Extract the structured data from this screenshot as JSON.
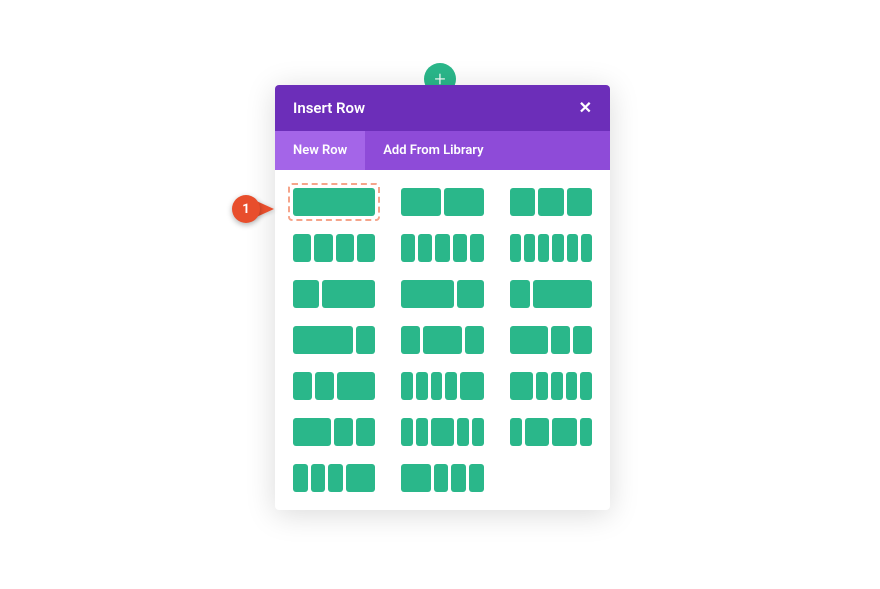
{
  "add_button": {
    "icon": "+"
  },
  "modal": {
    "title": "Insert Row",
    "close_icon": "✕",
    "tabs": [
      {
        "label": "New Row",
        "active": true
      },
      {
        "label": "Add From Library",
        "active": false
      }
    ]
  },
  "layouts": [
    {
      "cols": [
        1
      ],
      "selected": true
    },
    {
      "cols": [
        1,
        1
      ],
      "selected": false
    },
    {
      "cols": [
        1,
        1,
        1
      ],
      "selected": false
    },
    {
      "cols": [
        1,
        1,
        1,
        1
      ],
      "selected": false
    },
    {
      "cols": [
        1,
        1,
        1,
        1,
        1
      ],
      "selected": false
    },
    {
      "cols": [
        1,
        1,
        1,
        1,
        1,
        1
      ],
      "selected": false
    },
    {
      "cols": [
        1,
        2
      ],
      "selected": false
    },
    {
      "cols": [
        2,
        1
      ],
      "selected": false
    },
    {
      "cols": [
        1,
        3
      ],
      "selected": false
    },
    {
      "cols": [
        3,
        1
      ],
      "selected": false
    },
    {
      "cols": [
        1,
        2,
        1
      ],
      "selected": false
    },
    {
      "cols": [
        2,
        1,
        1
      ],
      "selected": false
    },
    {
      "cols": [
        1,
        1,
        2
      ],
      "selected": false
    },
    {
      "cols": [
        1,
        1,
        1,
        1,
        2
      ],
      "selected": false
    },
    {
      "cols": [
        2,
        1,
        1,
        1,
        1
      ],
      "selected": false
    },
    {
      "cols": [
        2,
        1,
        1
      ],
      "selected": false
    },
    {
      "cols": [
        1,
        1,
        2,
        1,
        1
      ],
      "selected": false
    },
    {
      "cols": [
        1,
        2,
        2,
        1
      ],
      "selected": false
    },
    {
      "cols": [
        1,
        1,
        1,
        2
      ],
      "selected": false
    },
    {
      "cols": [
        2,
        1,
        1,
        1
      ],
      "selected": false
    }
  ],
  "callout": {
    "number": "1"
  },
  "colors": {
    "accent": "#2ab78a",
    "header": "#6c2eb9",
    "tab_bg": "#8e4bd8",
    "tab_active": "#a465e8",
    "callout": "#e84e2c",
    "selection_border": "#f5a48a"
  }
}
